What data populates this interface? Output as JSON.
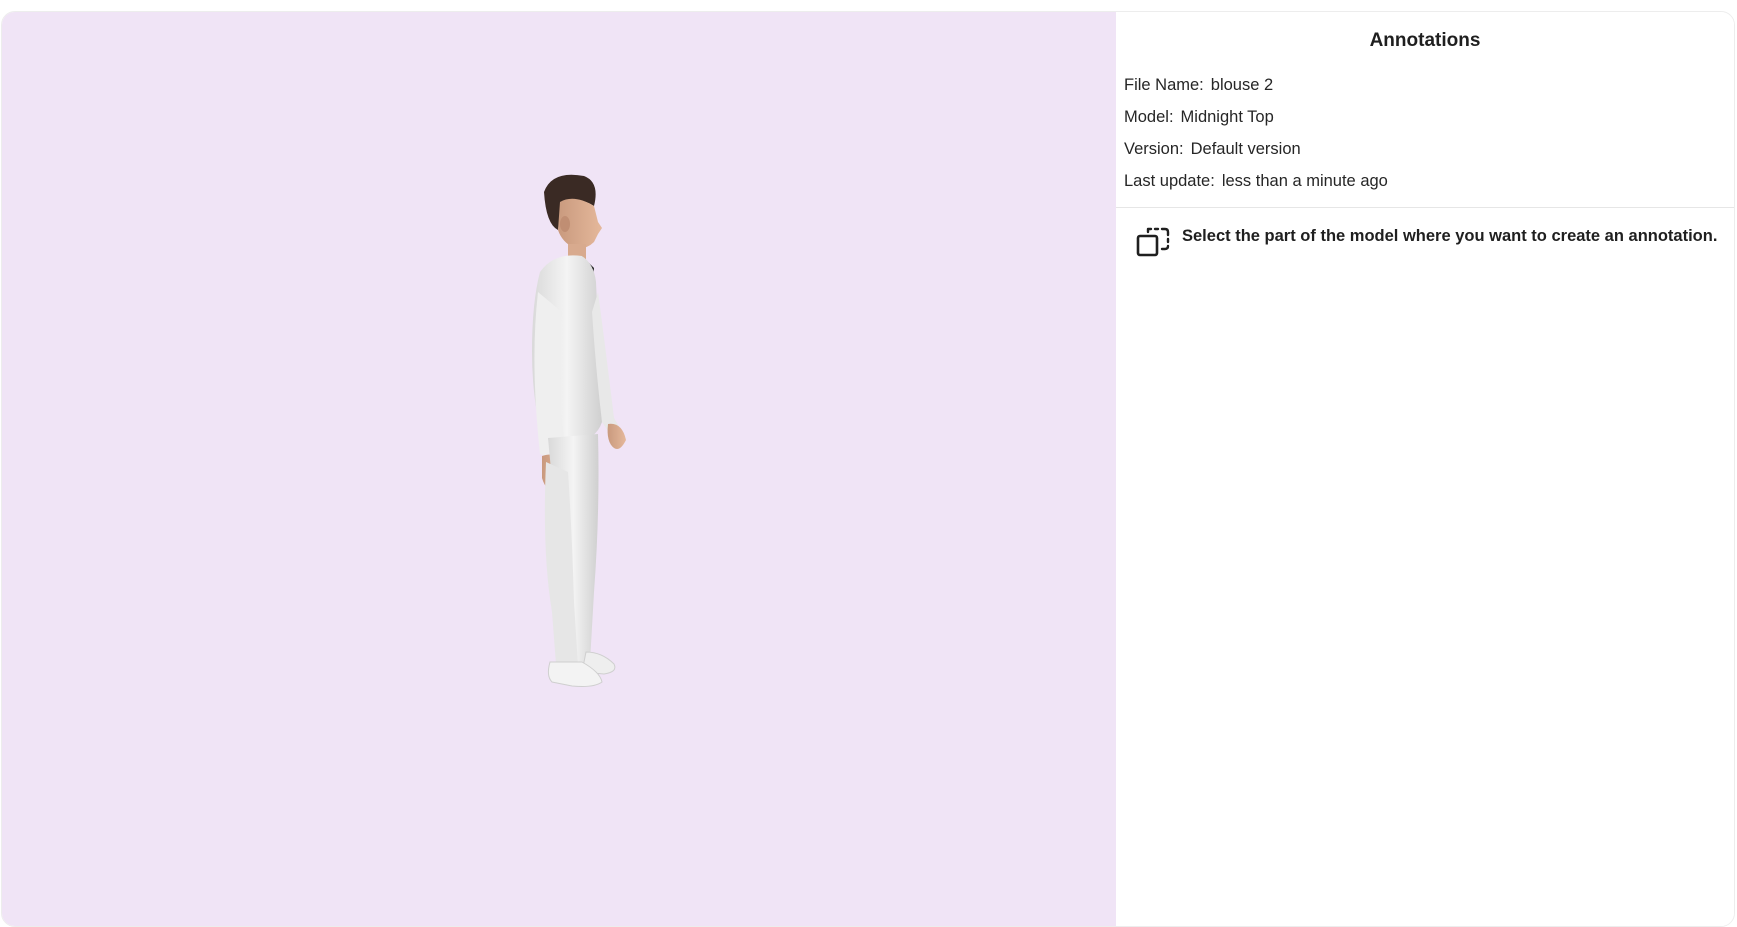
{
  "panel": {
    "title": "Annotations",
    "meta": [
      {
        "label": "File Name:",
        "value": "blouse 2"
      },
      {
        "label": "Model:",
        "value": "Midnight Top"
      },
      {
        "label": "Version:",
        "value": "Default version"
      },
      {
        "label": "Last update:",
        "value": "less than a minute ago"
      }
    ],
    "hint": {
      "icon": "select-area-icon",
      "text": "Select the part of the model where you want to create an annotation."
    }
  },
  "viewer": {
    "background": "#f0e4f6",
    "model_figure": "3d-model-man-white-outfit"
  },
  "colors": {
    "panel_bg": "#ffffff",
    "divider": "#e6e6e6",
    "text": "#1f1f1f"
  }
}
